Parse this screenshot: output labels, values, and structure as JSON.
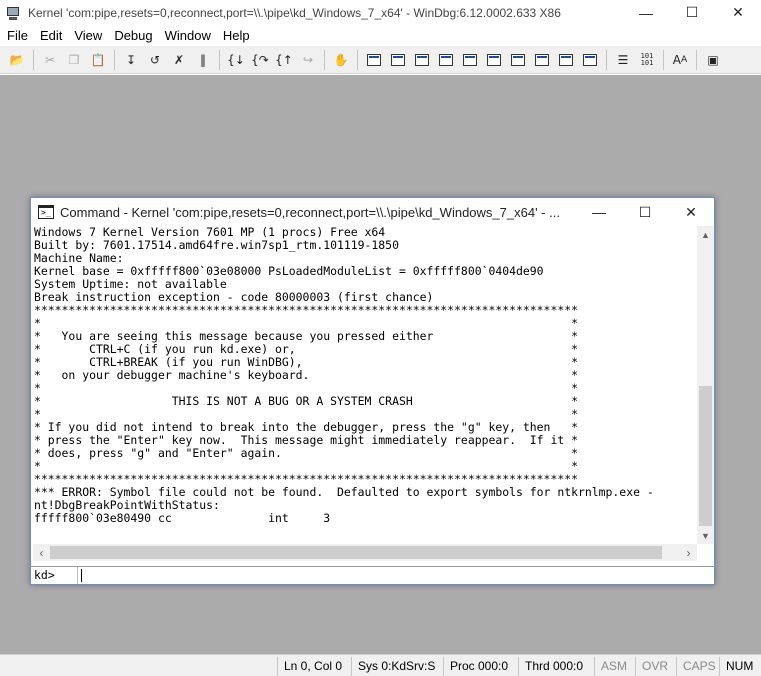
{
  "window": {
    "title": "Kernel 'com:pipe,resets=0,reconnect,port=\\\\.\\pipe\\kd_Windows_7_x64' - WinDbg:6.12.0002.633 X86",
    "minimize": "—",
    "maximize": "☐",
    "close": "✕"
  },
  "menu": {
    "items": [
      "File",
      "Edit",
      "View",
      "Debug",
      "Window",
      "Help"
    ]
  },
  "command_window": {
    "title": "Command - Kernel 'com:pipe,resets=0,reconnect,port=\\\\.\\pipe\\kd_Windows_7_x64' - ...",
    "output_lines": [
      "Windows 7 Kernel Version 7601 MP (1 procs) Free x64",
      "Built by: 7601.17514.amd64fre.win7sp1_rtm.101119-1850",
      "Machine Name:",
      "Kernel base = 0xfffff800`03e08000 PsLoadedModuleList = 0xfffff800`0404de90",
      "System Uptime: not available",
      "Break instruction exception - code 80000003 (first chance)",
      "*******************************************************************************",
      "*                                                                             *",
      "*   You are seeing this message because you pressed either                    *",
      "*       CTRL+C (if you run kd.exe) or,                                        *",
      "*       CTRL+BREAK (if you run WinDBG),                                       *",
      "*   on your debugger machine's keyboard.                                      *",
      "*                                                                             *",
      "*                   THIS IS NOT A BUG OR A SYSTEM CRASH                       *",
      "*                                                                             *",
      "* If you did not intend to break into the debugger, press the \"g\" key, then   *",
      "* press the \"Enter\" key now.  This message might immediately reappear.  If it *",
      "* does, press \"g\" and \"Enter\" again.                                          *",
      "*                                                                             *",
      "*******************************************************************************",
      "*** ERROR: Symbol file could not be found.  Defaulted to export symbols for ntkrnlmp.exe -",
      "nt!DbgBreakPointWithStatus:",
      "fffff800`03e80490 cc              int     3"
    ],
    "prompt": "kd>",
    "input_value": ""
  },
  "status_bar": {
    "position": "Ln 0, Col 0",
    "system": "Sys 0:KdSrv:S",
    "process": "Proc 000:0",
    "thread": "Thrd 000:0",
    "asm": "ASM",
    "ovr": "OVR",
    "caps": "CAPS",
    "num": "NUM"
  }
}
